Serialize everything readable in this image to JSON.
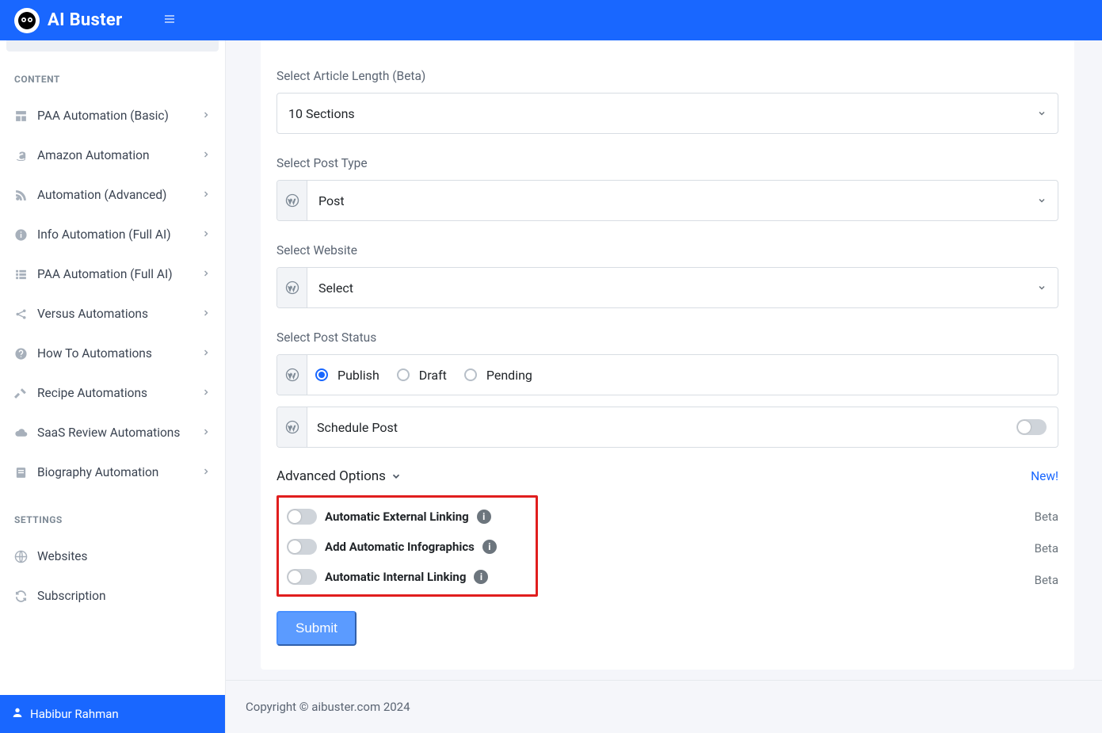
{
  "header": {
    "brand": "AI Buster"
  },
  "sidebar": {
    "sections": {
      "content_title": "CONTENT",
      "settings_title": "SETTINGS"
    },
    "items": {
      "paa_basic": "PAA Automation (Basic)",
      "amazon": "Amazon Automation",
      "automation_adv": "Automation (Advanced)",
      "info_full_ai": "Info Automation (Full AI)",
      "paa_full_ai": "PAA Automation (Full AI)",
      "versus": "Versus Automations",
      "howto": "How To Automations",
      "recipe": "Recipe Automations",
      "saas_review": "SaaS Review Automations",
      "biography": "Biography Automation",
      "websites": "Websites",
      "subscription": "Subscription"
    },
    "user": "Habibur Rahman"
  },
  "form": {
    "article_length_label": "Select Article Length (Beta)",
    "article_length_value": "10 Sections",
    "post_type_label": "Select Post Type",
    "post_type_value": "Post",
    "website_label": "Select Website",
    "website_value": "Select",
    "post_status_label": "Select Post Status",
    "status_publish": "Publish",
    "status_draft": "Draft",
    "status_pending": "Pending",
    "schedule_label": "Schedule Post",
    "advanced_title": "Advanced Options",
    "new_label": "New!",
    "adv_ext_linking": "Automatic External Linking",
    "adv_infographics": "Add Automatic Infographics",
    "adv_int_linking": "Automatic Internal Linking",
    "beta_badge": "Beta",
    "submit": "Submit"
  },
  "footer": {
    "copyright": "Copyright © aibuster.com 2024"
  }
}
